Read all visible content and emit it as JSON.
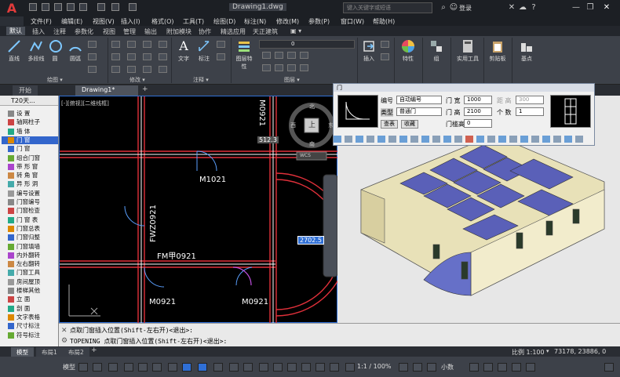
{
  "app": {
    "logo": "A",
    "title": "Drawing1.dwg",
    "search_placeholder": "键入关键字或短语",
    "login": "登录"
  },
  "menu": [
    "文件(F)",
    "编辑(E)",
    "视图(V)",
    "插入(I)",
    "格式(O)",
    "工具(T)",
    "绘图(D)",
    "标注(N)",
    "修改(M)",
    "参数(P)",
    "窗口(W)",
    "帮助(H)"
  ],
  "ribbon_tabs": [
    "默认",
    "插入",
    "注释",
    "参数化",
    "视图",
    "管理",
    "输出",
    "附加模块",
    "协作",
    "精选应用",
    "天正建筑"
  ],
  "ribbon": {
    "draw": [
      "直线",
      "多段线",
      "圆",
      "圆弧"
    ],
    "annot": [
      "文字",
      "标注"
    ],
    "layer_btn": "图层特性",
    "layer_value": "0",
    "right": [
      "插入",
      "特性",
      "组",
      "实用工具",
      "剪贴板",
      "基点"
    ],
    "panels": [
      "绘图 ▾",
      "修改 ▾",
      "注释 ▾",
      "图层 ▾"
    ]
  },
  "doc_tabs": [
    "开始",
    "Drawing1*"
  ],
  "side": {
    "header": "T20天...",
    "items": [
      "设  置",
      "轴网柱子",
      "墙  体",
      "门  窗",
      "门    窗",
      "组合门窗",
      "带 形 窗",
      "转 角 窗",
      "异 形 洞",
      "编号设置",
      "门窗编号",
      "门窗检查",
      "门 窗 表",
      "门窗总表",
      "门窗归整",
      "门窗填墙",
      "内外翻转",
      "左右翻转",
      "门窗工具",
      "房间屋顶",
      "楼梯其他",
      "立    面",
      "剖    面",
      "文字表格",
      "尺寸标注",
      "符号标注"
    ]
  },
  "canvas": {
    "viewport_label": "[-][俯视][二维线框]",
    "labels": [
      "M0921",
      "M1021",
      "FWZ0921",
      "FM甲0921",
      "M0921",
      "M0921"
    ],
    "dim1": "512.3",
    "dim2": "2702.5",
    "viewcube": {
      "top": "上",
      "north": "北",
      "south": "南",
      "west": "西",
      "east": "东",
      "wcs": "WCS"
    }
  },
  "door_panel": {
    "title": "门",
    "number_label": "编号",
    "number_value": "自动编号",
    "type_label": "类型",
    "type_value": "普通门",
    "width_label": "门  宽",
    "width_value": "1000",
    "height_label": "门  高",
    "height_value": "2100",
    "sill_label": "门槛高",
    "sill_value": "0",
    "dist_label": "距  高",
    "dist_value": "300",
    "count_label": "个  数",
    "count_value": "1",
    "btn_lookup": "查表",
    "btn_collect": "收藏"
  },
  "command": {
    "line1": "点取门窗插入位置(Shift-左右开)<退出>:",
    "line2": "TOPENING 点取门窗插入位置(Shift-左右开)<退出>:"
  },
  "layout_tabs": [
    "模型",
    "布局1",
    "布局2",
    "+"
  ],
  "status": {
    "model": "模型",
    "scale": "比例 1:100",
    "coords": "73178, 23886, 0",
    "annot_scale": "1:1 / 100%",
    "units": "小数"
  }
}
